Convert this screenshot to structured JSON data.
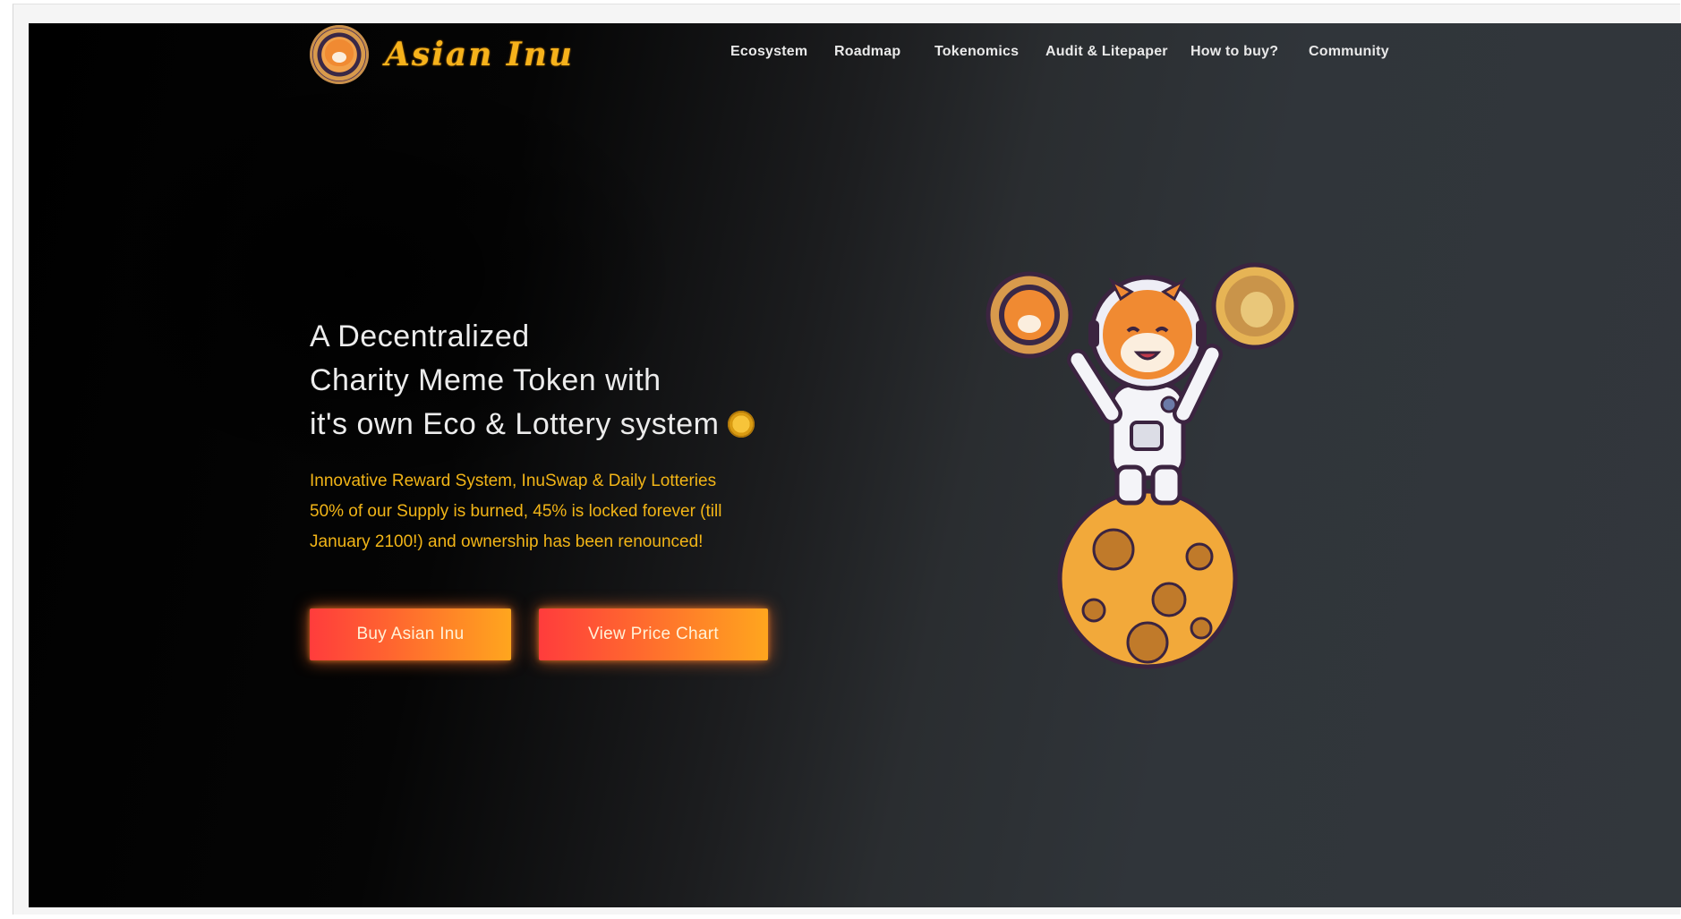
{
  "brand": {
    "name": "Asian Inu"
  },
  "nav": {
    "items": [
      {
        "label": "Ecosystem"
      },
      {
        "label": "Roadmap"
      },
      {
        "label": "Tokenomics"
      },
      {
        "label": "Audit & Litepaper"
      },
      {
        "label": "How to buy?"
      },
      {
        "label": "Community"
      }
    ]
  },
  "hero": {
    "headline_lines": [
      "A Decentralized",
      "Charity Meme Token with",
      "it's own Eco & Lottery system"
    ],
    "sub_lines": [
      "Innovative Reward System, InuSwap & Daily Lotteries",
      "50% of our Supply is burned, 45% is locked forever (till",
      "January 2100!) and ownership has been renounced!"
    ],
    "buttons": {
      "buy": "Buy Asian Inu",
      "chart": "View Price Chart"
    }
  },
  "colors": {
    "accent": "#f2b517",
    "button_start": "#ff3c3c",
    "button_end": "#ffa61e",
    "background_dark": "#000000",
    "background_light": "#32373c"
  },
  "icons": {
    "logo": "shiba-coin-logo-icon",
    "inline_coin": "coin-icon",
    "illustration": "astronaut-shiba-on-moon-illustration"
  }
}
